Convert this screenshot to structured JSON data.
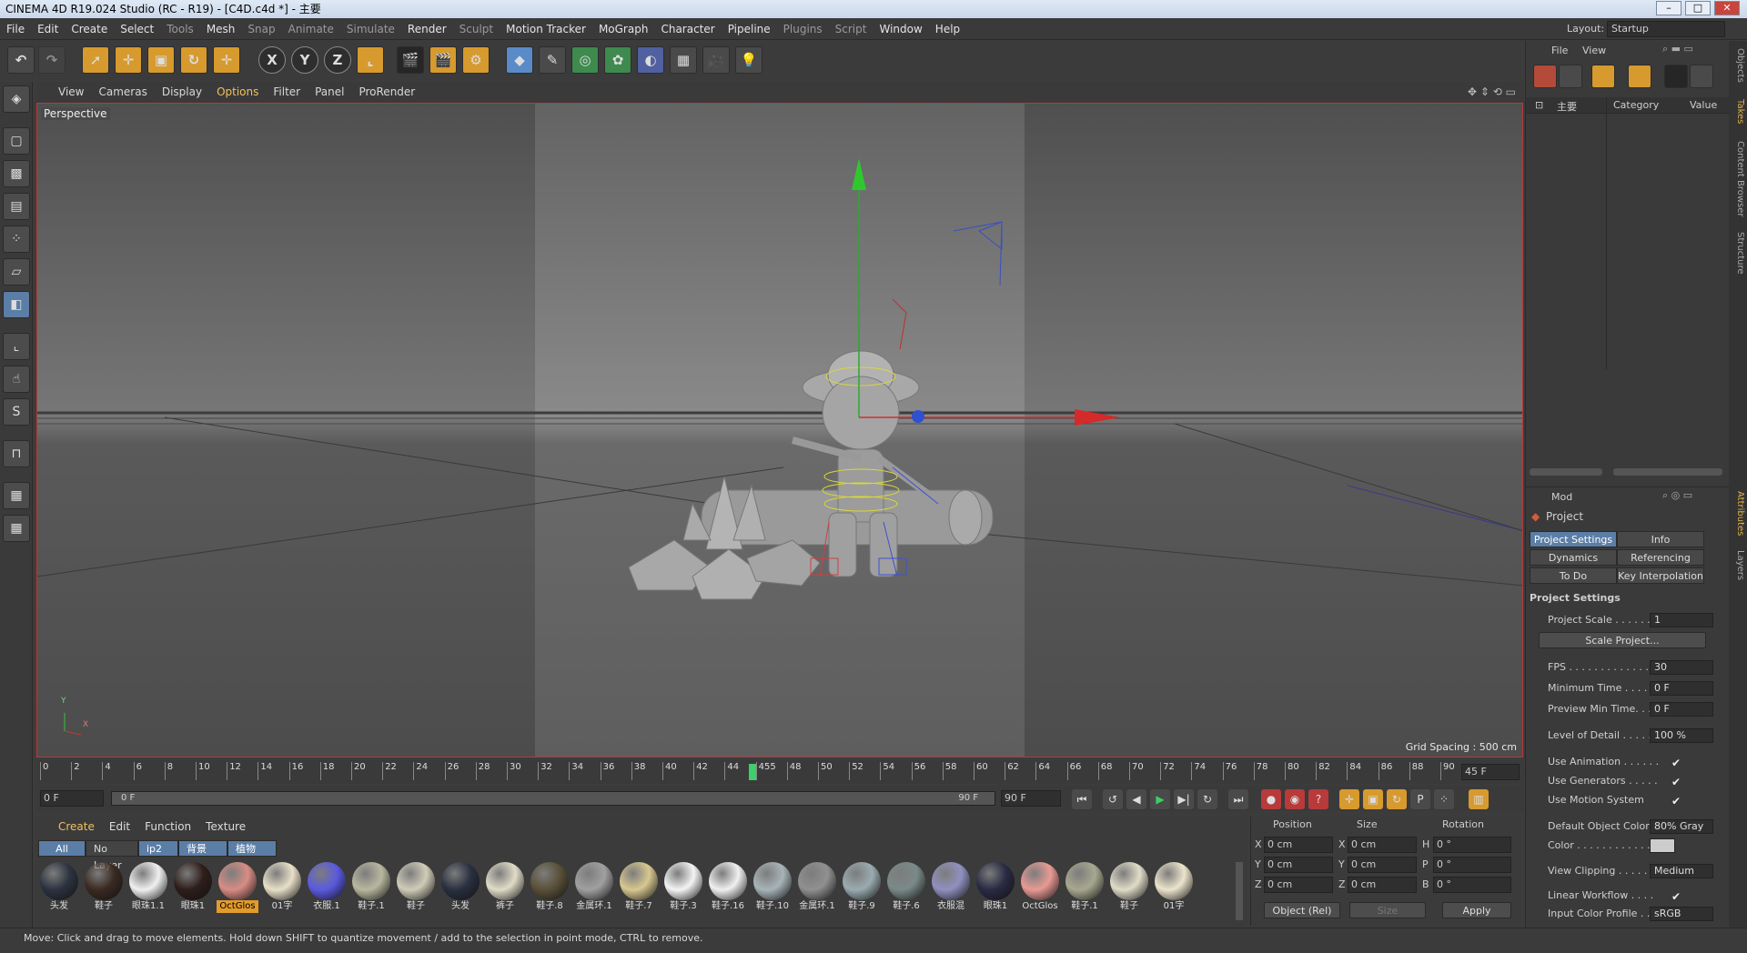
{
  "window": {
    "title": "CINEMA 4D R19.024 Studio (RC - R19) - [C4D.c4d *] - 主要",
    "layout_label": "Layout:",
    "layout_value": "Startup"
  },
  "menubar": [
    "File",
    "Edit",
    "Create",
    "Select",
    "Tools",
    "Mesh",
    "Snap",
    "Animate",
    "Simulate",
    "Render",
    "Sculpt",
    "Motion Tracker",
    "MoGraph",
    "Character",
    "Pipeline",
    "Plugins",
    "Script",
    "Window",
    "Help"
  ],
  "toolbar": {
    "axis_x": "X",
    "axis_y": "Y",
    "axis_z": "Z"
  },
  "viewport": {
    "menu": [
      "View",
      "Cameras",
      "Display",
      "Options",
      "Filter",
      "Panel",
      "ProRender"
    ],
    "camera_label": "Perspective",
    "grid_spacing": "Grid Spacing : 500 cm",
    "axis_y": "Y",
    "axis_x": "X"
  },
  "timeline": {
    "ticks": [
      "0",
      "2",
      "4",
      "6",
      "8",
      "10",
      "12",
      "14",
      "16",
      "18",
      "20",
      "22",
      "24",
      "26",
      "28",
      "30",
      "32",
      "34",
      "36",
      "38",
      "40",
      "42",
      "44",
      "455",
      "48",
      "50",
      "52",
      "54",
      "56",
      "58",
      "60",
      "62",
      "64",
      "66",
      "68",
      "70",
      "72",
      "74",
      "76",
      "78",
      "80",
      "82",
      "84",
      "86",
      "88",
      "90"
    ],
    "current_frame_field": "45 F",
    "start_field": "0 F",
    "range_start": "0 F",
    "range_end": "90 F",
    "end_field": "90 F"
  },
  "material_manager": {
    "menu": [
      "Create",
      "Edit",
      "Function",
      "Texture"
    ],
    "layers": [
      "All",
      "No Layer",
      "ip2",
      "背景",
      "植物"
    ],
    "materials": [
      {
        "label": "头发",
        "color": "#2c3340"
      },
      {
        "label": "鞋子",
        "color": "#3a2a22"
      },
      {
        "label": "眼珠1.1",
        "color": "#f0f0f0"
      },
      {
        "label": "眼珠1",
        "color": "#2e1e1a"
      },
      {
        "label": "OctGlos",
        "color": "#d88c84",
        "selected": true
      },
      {
        "label": "01字",
        "color": "#e8e0c8"
      },
      {
        "label": "衣服.1",
        "color": "#5a5ae0"
      },
      {
        "label": "鞋子.1",
        "color": "#b8b8a0"
      },
      {
        "label": "鞋子",
        "color": "#d0ccb8"
      },
      {
        "label": "头发",
        "color": "#2a3040"
      },
      {
        "label": "裤子",
        "color": "#e0dcc8"
      },
      {
        "label": "鞋子.8",
        "color": "#5a5038"
      },
      {
        "label": "金属环.1",
        "color": "#a0a0a0"
      },
      {
        "label": "鞋子.7",
        "color": "#d8c890"
      },
      {
        "label": "鞋子.3",
        "color": "#f4f4f4"
      },
      {
        "label": "鞋子.16",
        "color": "#f0f0f0"
      },
      {
        "label": "鞋子.10",
        "color": "#a8b4b8"
      },
      {
        "label": "金属环.1",
        "color": "#909090"
      },
      {
        "label": "鞋子.9",
        "color": "#9aacb0"
      },
      {
        "label": "鞋子.6",
        "color": "#7a8a88"
      },
      {
        "label": "衣服混",
        "color": "#9090c0"
      },
      {
        "label": "眼珠1",
        "color": "#2a2a44"
      },
      {
        "label": "OctGlos",
        "color": "#e89a94"
      },
      {
        "label": "鞋子.1",
        "color": "#a8a890"
      },
      {
        "label": "鞋子",
        "color": "#e0dcc8"
      },
      {
        "label": "01字",
        "color": "#ece4cc"
      }
    ]
  },
  "coordinates": {
    "headers": [
      "Position",
      "Size",
      "Rotation"
    ],
    "rows": [
      {
        "axis": "X",
        "pos": "0 cm",
        "size_axis": "X",
        "size": "0 cm",
        "rot_axis": "H",
        "rot": "0 °"
      },
      {
        "axis": "Y",
        "pos": "0 cm",
        "size_axis": "Y",
        "size": "0 cm",
        "rot_axis": "P",
        "rot": "0 °"
      },
      {
        "axis": "Z",
        "pos": "0 cm",
        "size_axis": "Z",
        "size": "0 cm",
        "rot_axis": "B",
        "rot": "0 °"
      }
    ],
    "mode": "Object (Rel)",
    "size_mode": "Size",
    "apply": "Apply"
  },
  "status": "Move: Click and drag to move elements. Hold down SHIFT to quantize movement / add to the selection in point mode, CTRL to remove.",
  "objects_panel": {
    "menu": [
      "File",
      "View"
    ],
    "tree_item": "主要",
    "col_category": "Category",
    "col_value": "Value"
  },
  "attributes": {
    "mode": "Mod",
    "title": "Project",
    "tabs": [
      "Project Settings",
      "Info",
      "Dynamics",
      "Referencing",
      "To Do",
      "Key Interpolation"
    ],
    "section": "Project Settings",
    "project_scale_label": "Project Scale . . . . . . .",
    "project_scale": "1",
    "scale_project_btn": "Scale Project...",
    "fps_label": "FPS . . . . . . . . . . . . . . . .",
    "fps": "30",
    "min_time_label": "Minimum Time . . . . . .",
    "min_time": "0 F",
    "preview_min_label": "Preview Min Time. . . .",
    "preview_min": "0 F",
    "lod_label": "Level of Detail . . . . . .",
    "lod": "100 %",
    "use_animation": "Use Animation . . . . . .",
    "use_generators": "Use Generators . . . . .",
    "use_motion": "Use Motion System",
    "default_color_label": "Default Object Color",
    "default_color": "80% Gray",
    "color_label": "Color . . . . . . . . . . . .",
    "view_clipping_label": "View Clipping . . . . . . .",
    "view_clipping": "Medium",
    "linear_workflow": "Linear Workflow . . . .",
    "input_color_label": "Input Color Profile . . .",
    "input_color": "sRGB",
    "check": "✔"
  },
  "dock_tabs": [
    "Objects",
    "Takes",
    "Content Browser",
    "Structure",
    "Attributes",
    "Layers"
  ]
}
